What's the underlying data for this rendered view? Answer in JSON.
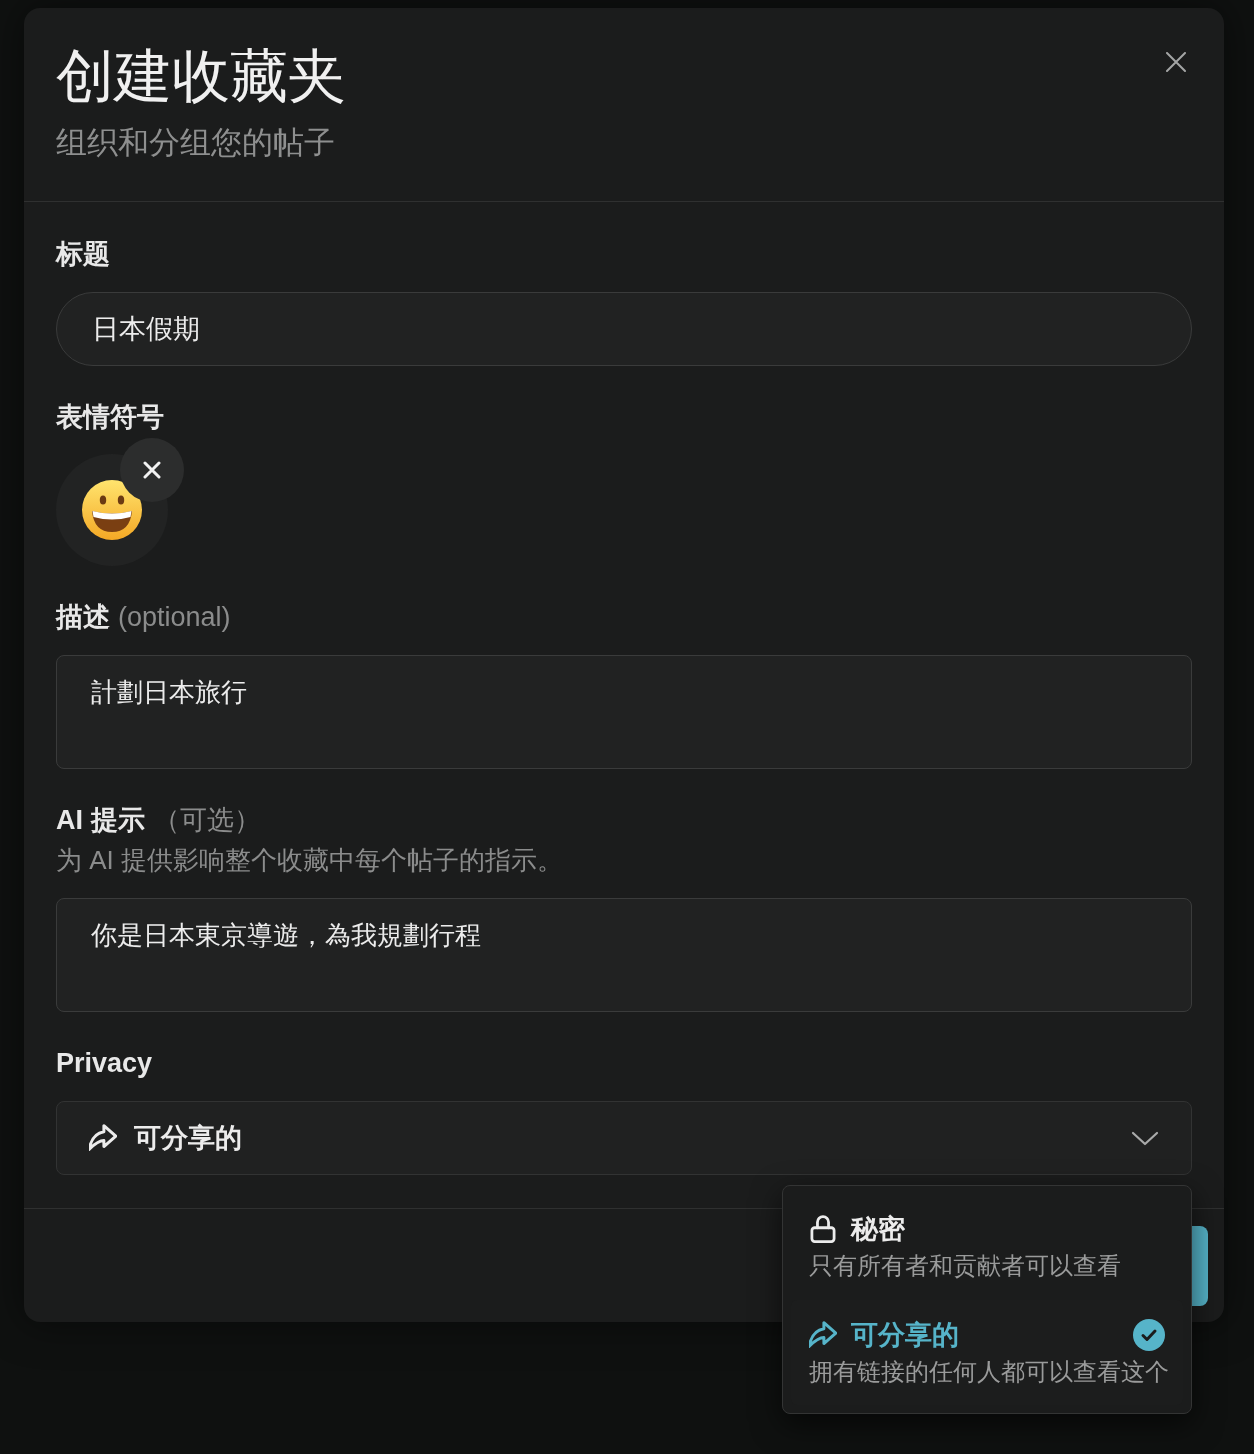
{
  "dialog": {
    "title": "创建收藏夹",
    "subtitle": "组织和分组您的帖子"
  },
  "fields": [
    {
      "kind": "text",
      "label": "标题",
      "value": "日本假期"
    },
    {
      "kind": "emoji",
      "label": "表情符号"
    },
    {
      "kind": "textarea",
      "label": "描述",
      "optional": "(optional)",
      "value": "計劃日本旅行"
    },
    {
      "kind": "textarea",
      "label": "AI 提示",
      "optional": "（可选）",
      "hint": "为 AI 提供影响整个收藏中每个帖子的指示。",
      "value": "你是日本東京導遊，為我規劃行程"
    },
    {
      "kind": "select",
      "label": "Privacy",
      "value": "可分享的"
    }
  ],
  "privacy_menu": {
    "options": [
      {
        "kind": "private",
        "label": "秘密",
        "description": "只有所有者和贡献者可以查看",
        "selected": false
      },
      {
        "kind": "shared",
        "label": "可分享的",
        "description": "拥有链接的任何人都可以查看这个",
        "selected": true
      }
    ]
  }
}
